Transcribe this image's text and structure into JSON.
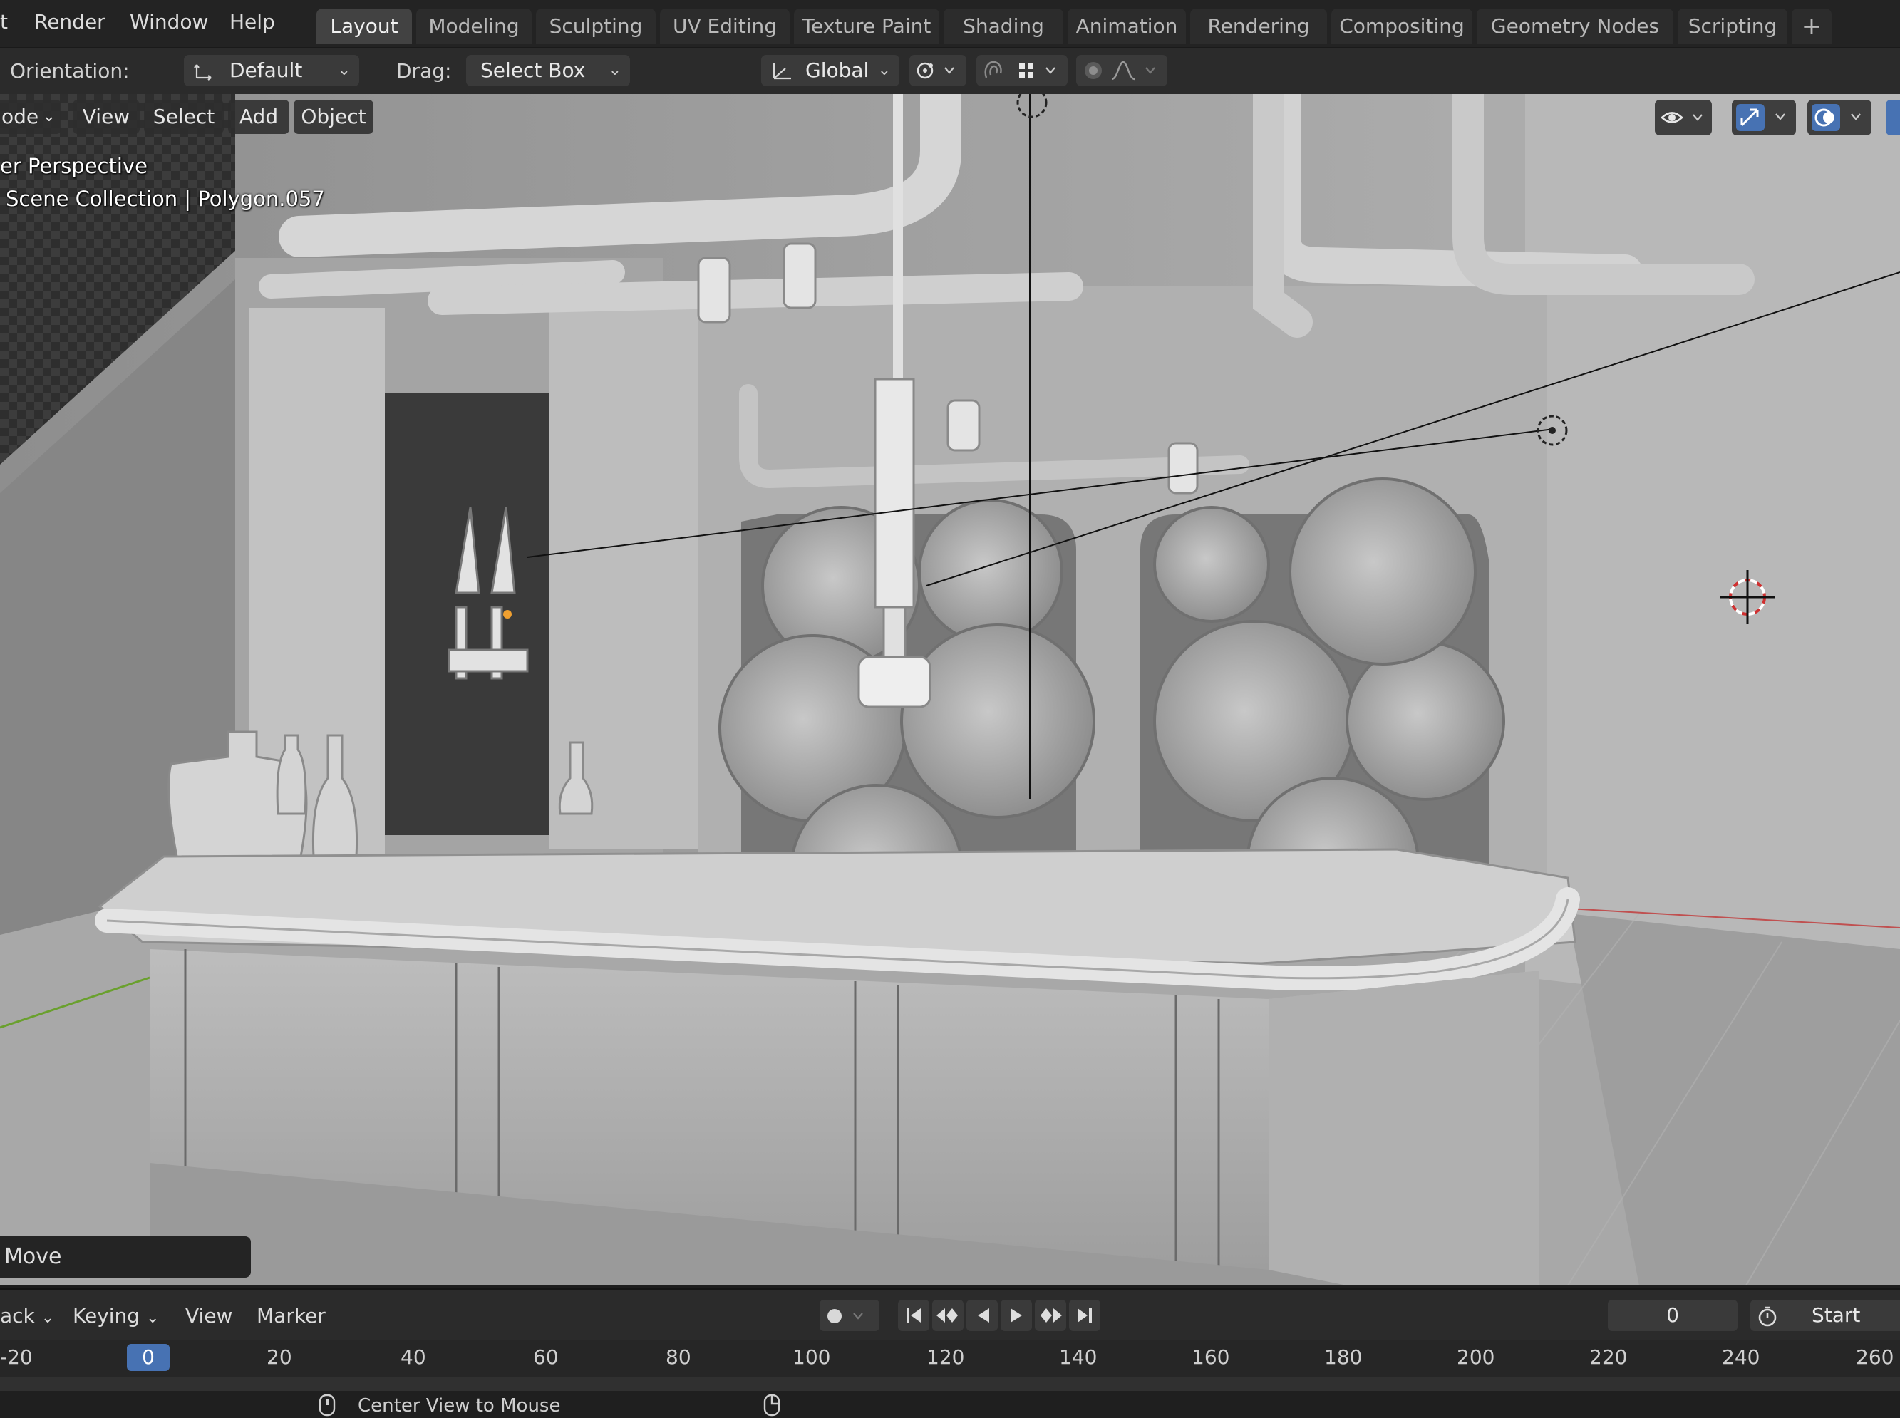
{
  "menu": {
    "items": [
      "t",
      "Render",
      "Window",
      "Help"
    ]
  },
  "workspaces": [
    "Layout",
    "Modeling",
    "Sculpting",
    "UV Editing",
    "Texture Paint",
    "Shading",
    "Animation",
    "Rendering",
    "Compositing",
    "Geometry Nodes",
    "Scripting"
  ],
  "workspace_add": "+",
  "tool_header": {
    "orientation_label": "Orientation:",
    "orientation_value": "Default",
    "drag_label": "Drag:",
    "drag_value": "Select Box",
    "transform_orientation": "Global"
  },
  "viewport": {
    "mode_label": "ode",
    "menus": [
      "View",
      "Select",
      "Add",
      "Object"
    ],
    "view_name": "er Perspective",
    "collection_info": "Scene Collection | Polygon.057",
    "operator_panel": "Move"
  },
  "timeline": {
    "playback_label": "ack",
    "keying_label": "Keying",
    "view_label": "View",
    "marker_label": "Marker",
    "current_frame": "0",
    "start_label": "Start",
    "ruler_ticks": [
      "-20",
      "0",
      "20",
      "40",
      "60",
      "80",
      "100",
      "120",
      "140",
      "160",
      "180",
      "200",
      "220",
      "240",
      "260"
    ]
  },
  "status_bar": {
    "hint": "Center View to Mouse"
  },
  "colors": {
    "accent": "#4772b3",
    "active_tab": "#424242",
    "header_bg": "#2b2b2b"
  }
}
